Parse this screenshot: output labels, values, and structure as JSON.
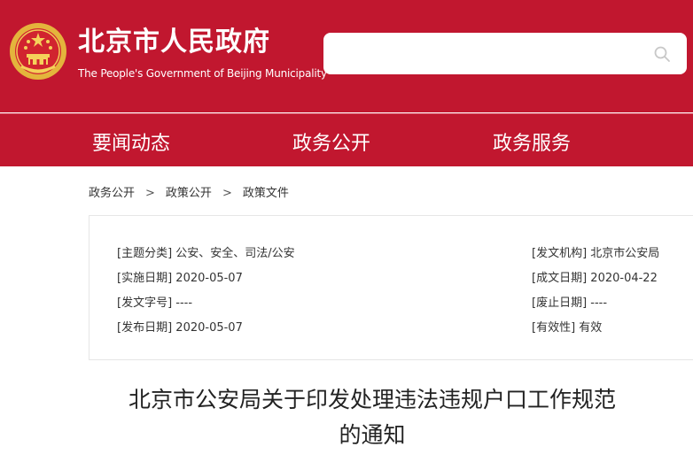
{
  "header": {
    "title": "北京市人民政府",
    "subtitle": "The People's Government of Beijing Municipality",
    "search": {
      "placeholder": ""
    },
    "colors": {
      "brand": "#c1172f"
    }
  },
  "nav": {
    "items": [
      {
        "label": "要闻动态"
      },
      {
        "label": "政务公开"
      },
      {
        "label": "政务服务"
      }
    ]
  },
  "breadcrumb": {
    "items": [
      "政务公开",
      "政策公开",
      "政策文件"
    ],
    "separator": ">"
  },
  "meta": {
    "left": [
      {
        "label": "[主题分类]",
        "value": "公安、安全、司法/公安"
      },
      {
        "label": "[实施日期]",
        "value": "2020-05-07"
      },
      {
        "label": "[发文字号]",
        "value": "----"
      },
      {
        "label": "[发布日期]",
        "value": "2020-05-07"
      }
    ],
    "right": [
      {
        "label": "[发文机构]",
        "value": "北京市公安局"
      },
      {
        "label": "[成文日期]",
        "value": "2020-04-22"
      },
      {
        "label": "[废止日期]",
        "value": "----"
      },
      {
        "label": "[有效性]",
        "value": "有效"
      }
    ]
  },
  "document": {
    "title_line1": "北京市公安局关于印发处理违法违规户口工作规范",
    "title_line2": "的通知"
  }
}
